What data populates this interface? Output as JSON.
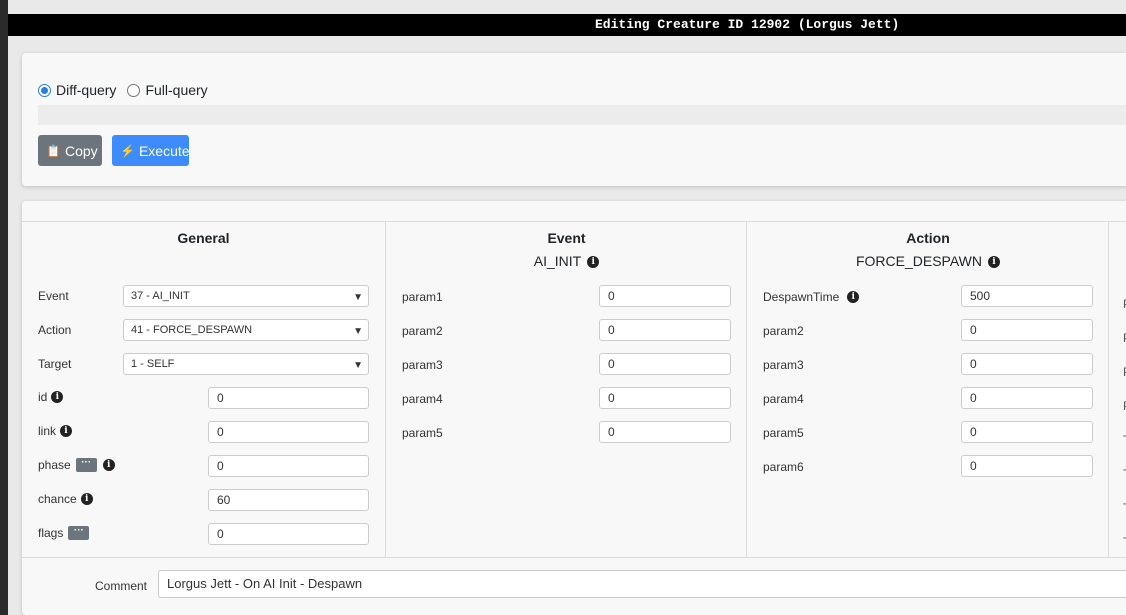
{
  "window": {
    "title": "Editing Creature ID 12902 (Lorgus Jett)"
  },
  "query": {
    "modes": [
      {
        "label": "Diff-query",
        "checked": true
      },
      {
        "label": "Full-query",
        "checked": false
      }
    ],
    "copy_label": "Copy",
    "execute_label": "Execute",
    "copy_icon": "clipboard-icon",
    "execute_icon": "bolt-icon",
    "accent_color": "#3d8bfd"
  },
  "general": {
    "title": "General",
    "event": {
      "label": "Event",
      "value": "37 - AI_INIT"
    },
    "action": {
      "label": "Action",
      "value": "41 - FORCE_DESPAWN"
    },
    "target": {
      "label": "Target",
      "value": "1 - SELF"
    },
    "id": {
      "label": "id",
      "value": "0"
    },
    "link": {
      "label": "link",
      "value": "0"
    },
    "phase": {
      "label": "phase",
      "value": "0"
    },
    "chance": {
      "label": "chance",
      "value": "60"
    },
    "flags": {
      "label": "flags",
      "value": "0"
    },
    "more_label": "···"
  },
  "event": {
    "title": "Event",
    "subtitle": "AI_INIT",
    "params": [
      {
        "label": "param1",
        "value": "0"
      },
      {
        "label": "param2",
        "value": "0"
      },
      {
        "label": "param3",
        "value": "0"
      },
      {
        "label": "param4",
        "value": "0"
      },
      {
        "label": "param5",
        "value": "0"
      }
    ]
  },
  "action": {
    "title": "Action",
    "subtitle": "FORCE_DESPAWN",
    "params": [
      {
        "label": "DespawnTime",
        "value": "500"
      },
      {
        "label": "param2",
        "value": "0"
      },
      {
        "label": "param3",
        "value": "0"
      },
      {
        "label": "param4",
        "value": "0"
      },
      {
        "label": "param5",
        "value": "0"
      },
      {
        "label": "param6",
        "value": "0"
      }
    ]
  },
  "target_partial": {
    "labels": [
      "P",
      "P",
      "P",
      "P",
      "T",
      "T",
      "T",
      "T"
    ]
  },
  "comment": {
    "label": "Comment",
    "value": "Lorgus Jett - On AI Init - Despawn"
  },
  "info_glyph": "i"
}
